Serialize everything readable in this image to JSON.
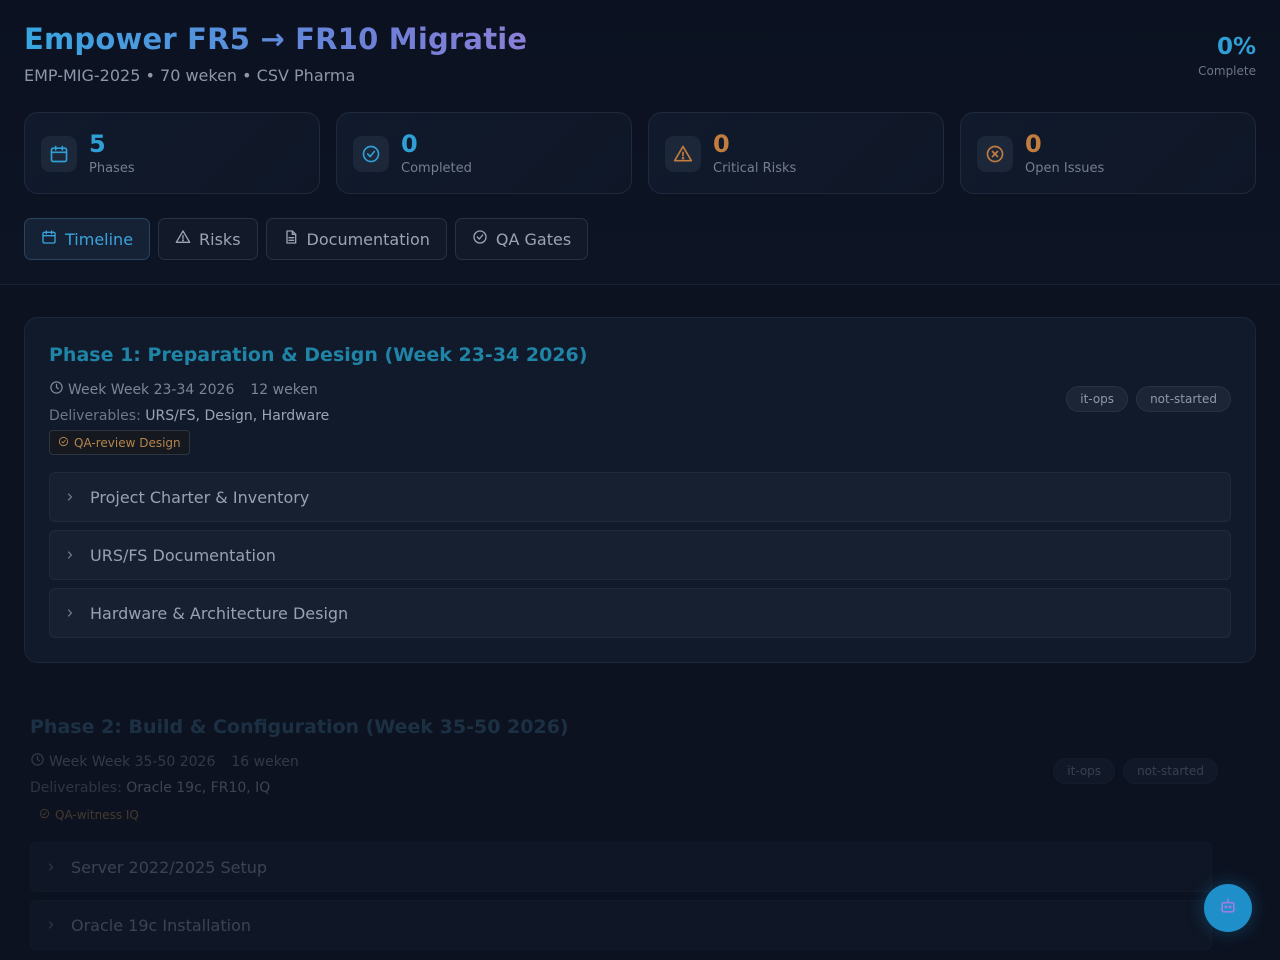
{
  "header": {
    "title": "Empower FR5 → FR10 Migratie",
    "subtitle": "EMP-MIG-2025 • 70 weken • CSV Pharma",
    "progress_value": "0%",
    "progress_label": "Complete"
  },
  "stats": [
    {
      "value": "5",
      "label": "Phases",
      "icon": "calendar-icon",
      "color": "#2f9fd6"
    },
    {
      "value": "0",
      "label": "Completed",
      "icon": "check-circle-icon",
      "color": "#2f9fd6"
    },
    {
      "value": "0",
      "label": "Critical Risks",
      "icon": "warning-icon",
      "color": "#c27c3e"
    },
    {
      "value": "0",
      "label": "Open Issues",
      "icon": "x-circle-icon",
      "color": "#c27c3e"
    }
  ],
  "tabs": [
    {
      "label": "Timeline",
      "icon": "calendar-icon",
      "active": true
    },
    {
      "label": "Risks",
      "icon": "warning-icon",
      "active": false
    },
    {
      "label": "Documentation",
      "icon": "document-icon",
      "active": false
    },
    {
      "label": "QA Gates",
      "icon": "check-circle-icon",
      "active": false
    }
  ],
  "phases": [
    {
      "title": "Phase 1: Preparation & Design (Week 23-34 2026)",
      "week": "Week Week 23-34 2026",
      "duration": "12 weken",
      "deliverables_label": "Deliverables:",
      "deliverables": "URS/FS, Design, Hardware",
      "qa": "QA-review Design",
      "badges": [
        "it-ops",
        "not-started"
      ],
      "tasks": [
        "Project Charter & Inventory",
        "URS/FS Documentation",
        "Hardware & Architecture Design"
      ]
    },
    {
      "title": "Phase 2: Build & Configuration (Week 35-50 2026)",
      "week": "Week Week 35-50 2026",
      "duration": "16 weken",
      "deliverables_label": "Deliverables:",
      "deliverables": "Oracle 19c, FR10, IQ",
      "qa": "QA-witness IQ",
      "badges": [
        "it-ops",
        "not-started"
      ],
      "tasks": [
        "Server 2022/2025 Setup",
        "Oracle 19c Installation"
      ]
    }
  ],
  "fab": {
    "icon": "robot-icon"
  }
}
